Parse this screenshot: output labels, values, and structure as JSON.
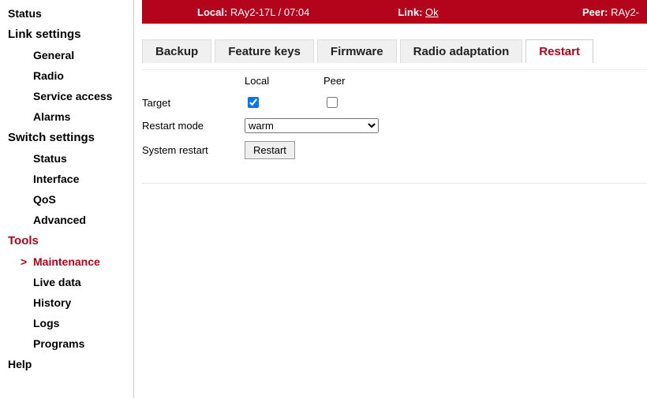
{
  "topbar": {
    "local_label": "Local:",
    "local_value": "RAy2-17L / 07:04",
    "link_label": "Link:",
    "link_value": "Ok",
    "peer_label": "Peer:",
    "peer_value": "RAy2-"
  },
  "sidebar": {
    "groups": [
      {
        "label": "Status",
        "no_children": true
      },
      {
        "label": "Link settings",
        "items": [
          "General",
          "Radio",
          "Service access",
          "Alarms"
        ]
      },
      {
        "label": "Switch settings",
        "items": [
          "Status",
          "Interface",
          "QoS",
          "Advanced"
        ]
      },
      {
        "label": "Tools",
        "active": true,
        "items": [
          "Maintenance",
          "Live data",
          "History",
          "Logs",
          "Programs"
        ],
        "active_item": 0
      },
      {
        "label": "Help",
        "no_children": true
      }
    ]
  },
  "tabs": [
    "Backup",
    "Feature keys",
    "Firmware",
    "Radio adaptation",
    "Restart"
  ],
  "active_tab": 4,
  "form": {
    "col_local": "Local",
    "col_peer": "Peer",
    "target_label": "Target",
    "target_local_checked": true,
    "target_peer_checked": false,
    "mode_label": "Restart mode",
    "mode_options": [
      "warm"
    ],
    "mode_selected": "warm",
    "restart_row_label": "System restart",
    "restart_button": "Restart"
  }
}
